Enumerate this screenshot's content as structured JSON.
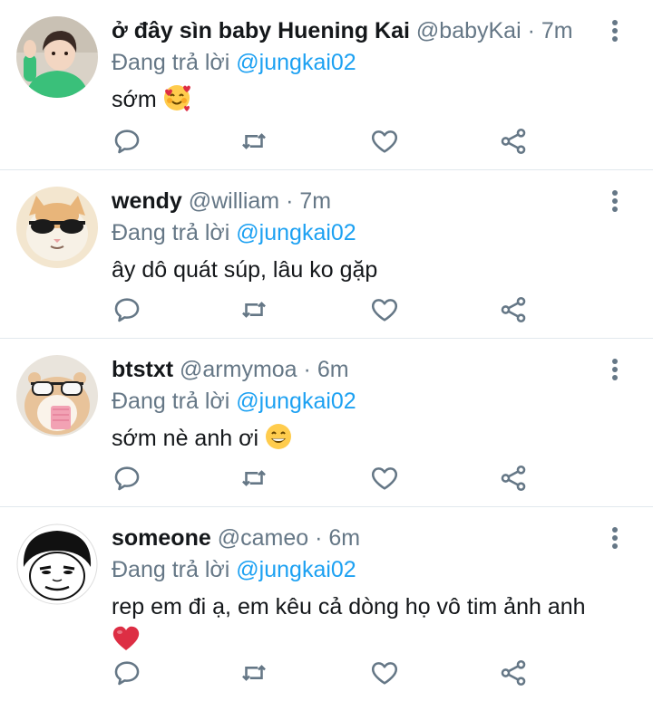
{
  "icon_color": "#657786",
  "mention_color": "#1da1f2",
  "tweets": [
    {
      "name": "ở đây sìn baby Huening Kai",
      "handle": "@babyKai",
      "separator": "·",
      "time": "7m",
      "reply_prefix": "Đang trả lời",
      "reply_to": "@jungkai02",
      "text": "sớm",
      "emoji": "smiling-face-with-hearts",
      "avatar": "boy-green-hoodie"
    },
    {
      "name": "wendy",
      "handle": "@william",
      "separator": "·",
      "time": "7m",
      "reply_prefix": "Đang trả lời",
      "reply_to": "@jungkai02",
      "text": "ây dô quát súp, lâu ko gặp",
      "avatar": "cat-sunglasses"
    },
    {
      "name": "btstxt",
      "handle": "@armymoa",
      "separator": "·",
      "time": "6m",
      "reply_prefix": "Đang trả lời",
      "reply_to": "@jungkai02",
      "text": "sớm nè anh ơi",
      "emoji": "grinning-face",
      "avatar": "hamster-sunglasses"
    },
    {
      "name": "someone",
      "handle": "@cameo",
      "separator": "·",
      "time": "6m",
      "reply_prefix": "Đang trả lời",
      "reply_to": "@jungkai02",
      "text": "rep em đi ạ, em kêu cả dòng họ vô tim ảnh anh",
      "emoji": "red-heart",
      "avatar": "meme-face"
    }
  ]
}
